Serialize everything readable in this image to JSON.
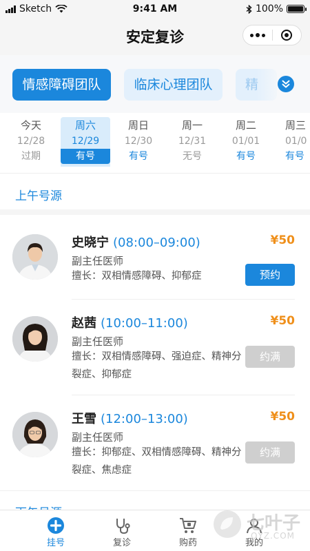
{
  "status_bar": {
    "carrier": "Sketch",
    "time": "9:41 AM",
    "battery": "100%",
    "battery_level": 1.0
  },
  "nav": {
    "title": "安定复诊"
  },
  "teams": [
    {
      "label": "情感障碍团队"
    },
    {
      "label": "临床心理团队"
    },
    {
      "label": "精"
    }
  ],
  "dates": [
    {
      "weekday": "今天",
      "date": "12/28",
      "status": "过期"
    },
    {
      "weekday": "周六",
      "date": "12/29",
      "status": "有号"
    },
    {
      "weekday": "周日",
      "date": "12/30",
      "status": "有号"
    },
    {
      "weekday": "周一",
      "date": "12/31",
      "status": "无号"
    },
    {
      "weekday": "周二",
      "date": "01/01",
      "status": "有号"
    },
    {
      "weekday": "周三",
      "date": "01/0",
      "status": "有号"
    }
  ],
  "morning": {
    "title": "上午号源"
  },
  "afternoon": {
    "title": "下午号源"
  },
  "doctors": [
    {
      "name": "史晓宁",
      "slot": "(08:00–09:00)",
      "title": "副主任医师",
      "skill": "擅长：双相情感障碍、抑郁症",
      "price": "¥50",
      "action": "预约"
    },
    {
      "name": "赵茜",
      "slot": "(10:00–11:00)",
      "title": "副主任医师",
      "skill": "擅长：双相情感障碍、强迫症、精神分裂症、抑郁症",
      "price": "¥50",
      "action": "约满"
    },
    {
      "name": "王雪",
      "slot": "(12:00–13:00)",
      "title": "副主任医师",
      "skill": "擅长：抑郁症、双相情感障碍、精神分裂症、焦虑症",
      "price": "¥50",
      "action": "约满"
    }
  ],
  "tabbar": [
    {
      "label": "挂号",
      "icon": "plus-circle-icon"
    },
    {
      "label": "复诊",
      "icon": "stethoscope-icon"
    },
    {
      "label": "购药",
      "icon": "cart-icon"
    },
    {
      "label": "我的",
      "icon": "user-icon"
    }
  ],
  "watermark": {
    "text": "七叶子",
    "subtext": "QYZ.COM"
  },
  "colors": {
    "accent": "#1b87dc",
    "price": "#ef8f1a",
    "disabled": "#cfcfcf"
  }
}
